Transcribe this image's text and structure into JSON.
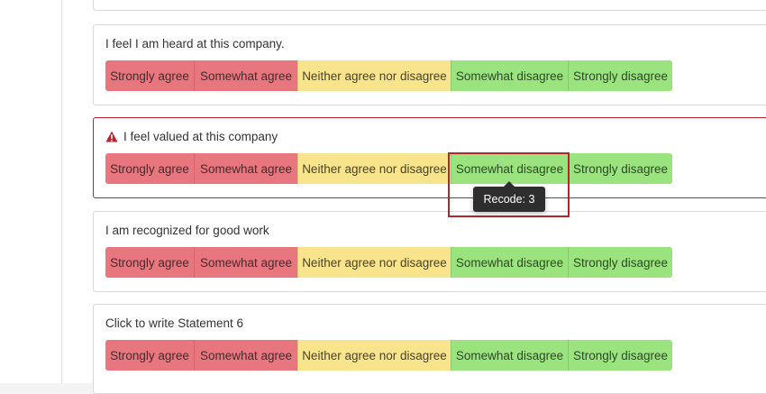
{
  "questions": [
    {
      "text": "I feel I am heard at this company.",
      "options": [
        "Strongly agree",
        "Somewhat agree",
        "Neither agree nor disagree",
        "Somewhat disagree",
        "Strongly disagree"
      ]
    },
    {
      "text": "I feel valued at this company",
      "has_error": true,
      "options": [
        "Strongly agree",
        "Somewhat agree",
        "Neither agree nor disagree",
        "Somewhat disagree",
        "Strongly disagree"
      ]
    },
    {
      "text": "I am recognized for good work",
      "options": [
        "Strongly agree",
        "Somewhat agree",
        "Neither agree nor disagree",
        "Somewhat disagree",
        "Strongly disagree"
      ]
    },
    {
      "text": "Click to write Statement 6",
      "options": [
        "Strongly agree",
        "Somewhat agree",
        "Neither agree nor disagree",
        "Somewhat disagree",
        "Strongly disagree"
      ]
    }
  ],
  "tooltip": {
    "text": "Recode: 3"
  },
  "icons": {
    "warning": "warning-triangle-icon"
  },
  "colors": {
    "agree": "#e8767f",
    "neutral": "#f9e48e",
    "disagree": "#9be37e",
    "error": "#b3262d"
  }
}
